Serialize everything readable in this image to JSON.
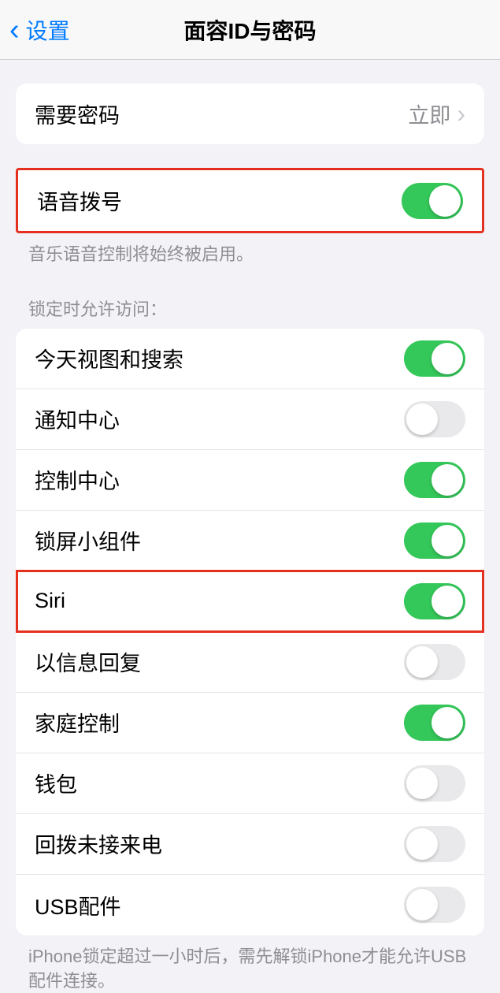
{
  "header": {
    "back_label": "设置",
    "title": "面容ID与密码"
  },
  "require_passcode": {
    "label": "需要密码",
    "value": "立即"
  },
  "voice_dial": {
    "label": "语音拨号",
    "enabled": true,
    "footer": "音乐语音控制将始终被启用。"
  },
  "lock_section": {
    "header": "锁定时允许访问：",
    "items": [
      {
        "label": "今天视图和搜索",
        "enabled": true
      },
      {
        "label": "通知中心",
        "enabled": false
      },
      {
        "label": "控制中心",
        "enabled": true
      },
      {
        "label": "锁屏小组件",
        "enabled": true
      },
      {
        "label": "Siri",
        "enabled": true,
        "highlighted": true
      },
      {
        "label": "以信息回复",
        "enabled": false
      },
      {
        "label": "家庭控制",
        "enabled": true
      },
      {
        "label": "钱包",
        "enabled": false
      },
      {
        "label": "回拨未接来电",
        "enabled": false
      },
      {
        "label": "USB配件",
        "enabled": false
      }
    ],
    "footer": "iPhone锁定超过一小时后，需先解锁iPhone才能允许USB配件连接。"
  }
}
